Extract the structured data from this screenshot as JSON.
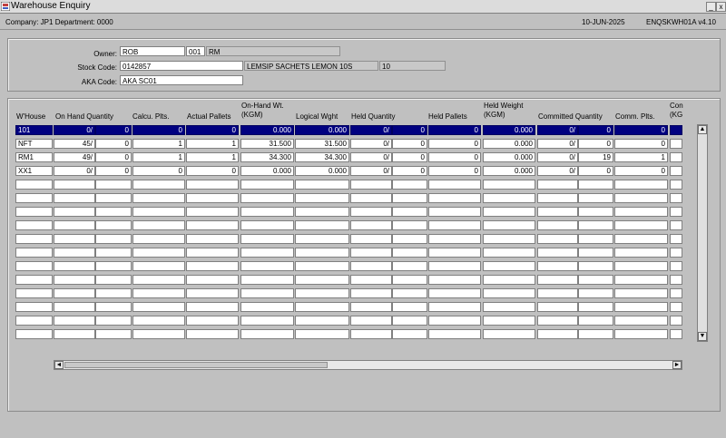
{
  "window": {
    "title": "Warehouse Enquiry",
    "minimize": "_",
    "close": "x"
  },
  "status": {
    "company": "Company:  JP1   Department:  0000",
    "date": "10-JUN-2025",
    "program": "ENQSKWH01A  v4.10"
  },
  "form": {
    "owner_label": "Owner:",
    "owner": "ROB",
    "owner_code": "001",
    "owner_name": "RM",
    "stock_label": "Stock Code:",
    "stock_code": "0142857",
    "stock_desc": "LEMSIP SACHETS LEMON 10S",
    "stock_pack": "10",
    "aka_label": "AKA Code:",
    "aka_code": "AKA SC01"
  },
  "grid": {
    "headers": [
      "W'House",
      "On Hand Quantity",
      "Calcu. Plts.",
      "Actual Pallets",
      "On-Hand Wt.\n(KGM)",
      "Logical Wght",
      "Held Quantity",
      "Held Pallets",
      "Held Weight\n(KGM)",
      "Committed Quantity",
      "Comm. Plts.",
      "Con\n(KG"
    ],
    "rows": [
      [
        "101",
        "0/",
        "0",
        "0",
        "0",
        "0.000",
        "0.000",
        "0/",
        "0",
        "0",
        "0.000",
        "0/",
        "0",
        "0",
        ""
      ],
      [
        "NFT",
        "45/",
        "0",
        "1",
        "1",
        "31.500",
        "31.500",
        "0/",
        "0",
        "0",
        "0.000",
        "0/",
        "0",
        "0",
        ""
      ],
      [
        "RM1",
        "49/",
        "0",
        "1",
        "1",
        "34.300",
        "34.300",
        "0/",
        "0",
        "0",
        "0.000",
        "0/",
        "19",
        "1",
        ""
      ],
      [
        "XX1",
        "0/",
        "0",
        "0",
        "0",
        "0.000",
        "0.000",
        "0/",
        "0",
        "0",
        "0.000",
        "0/",
        "0",
        "0",
        ""
      ]
    ],
    "empty_rows": 12
  },
  "scroll": {
    "up": "▲",
    "down": "▼",
    "left": "◄",
    "right": "►"
  }
}
